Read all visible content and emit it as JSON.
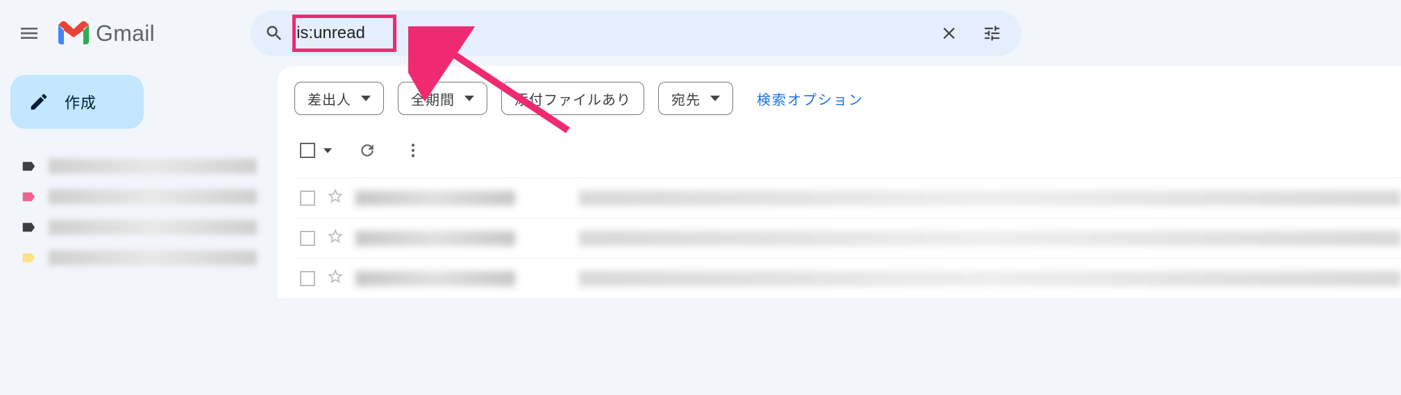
{
  "header": {
    "product_name": "Gmail"
  },
  "search": {
    "query": "is:unread"
  },
  "compose": {
    "label": "作成"
  },
  "sidebar": {
    "labels": [
      {
        "color": "#3c4043"
      },
      {
        "color": "#f06292"
      },
      {
        "color": "#3c4043"
      },
      {
        "color": "#ffe082"
      }
    ]
  },
  "filter_chips": {
    "sender": "差出人",
    "time_range": "全期間",
    "has_attachment": "添付ファイルあり",
    "to": "宛先",
    "search_options": "検索オプション"
  },
  "mail_rows": 3
}
